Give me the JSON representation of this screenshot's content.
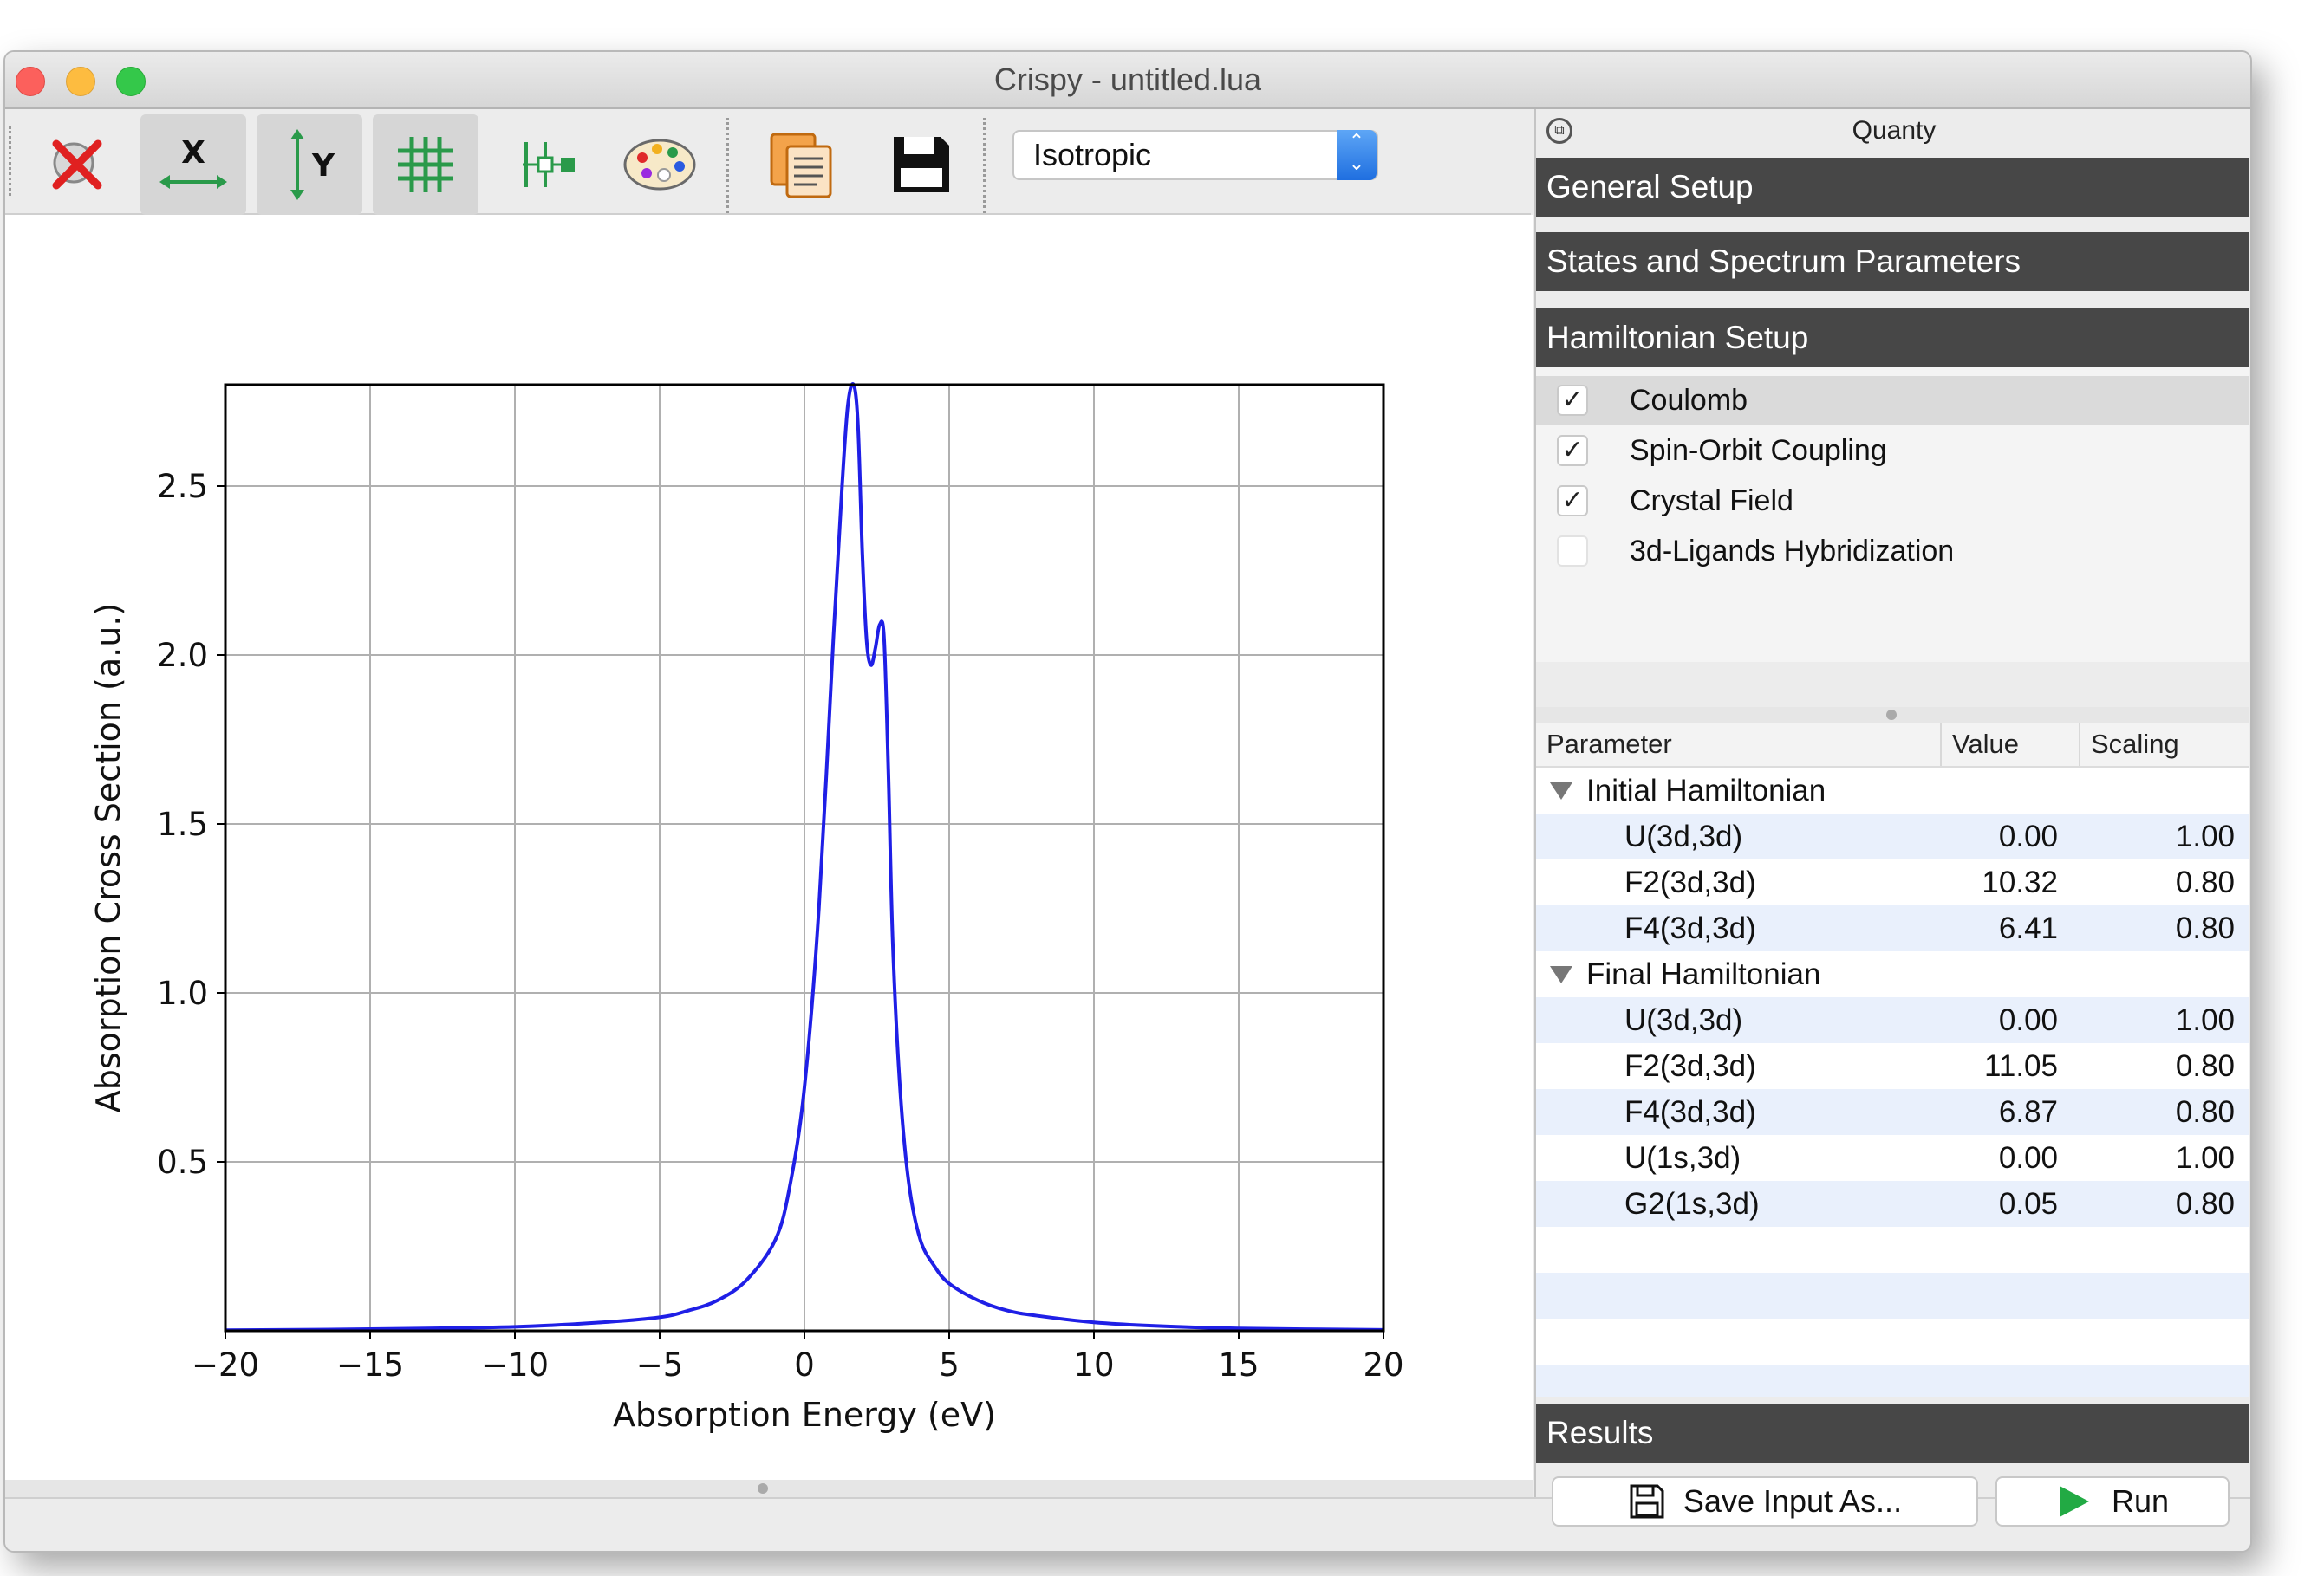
{
  "window": {
    "title": "Crispy - untitled.lua"
  },
  "toolbar": {
    "buttons": [
      {
        "name": "clear-plot",
        "icon": "clear-plot-icon"
      },
      {
        "name": "autoscale-x",
        "icon": "x-axis-scale-icon",
        "label": "X"
      },
      {
        "name": "autoscale-y",
        "icon": "y-axis-scale-icon",
        "label": "Y"
      },
      {
        "name": "grid",
        "icon": "grid-icon"
      },
      {
        "name": "curve-style",
        "icon": "curve-style-icon"
      },
      {
        "name": "colormap",
        "icon": "palette-icon"
      },
      {
        "name": "copy",
        "icon": "copy-icon"
      },
      {
        "name": "save",
        "icon": "save-icon"
      }
    ],
    "combo_value": "Isotropic"
  },
  "chart_data": {
    "type": "line",
    "title": "",
    "xlabel": "Absorption Energy (eV)",
    "ylabel": "Absorption Cross Section (a.u.)",
    "xlim": [
      -20,
      20
    ],
    "ylim": [
      0,
      2.8
    ],
    "xticks": [
      -20,
      -15,
      -10,
      -5,
      0,
      5,
      10,
      15,
      20
    ],
    "xticklabels": [
      "−20",
      "−15",
      "−10",
      "−5",
      "0",
      "5",
      "10",
      "15",
      "20"
    ],
    "yticks": [
      0.5,
      1.0,
      1.5,
      2.0,
      2.5
    ],
    "yticklabels": [
      "0.5",
      "1.0",
      "1.5",
      "2.0",
      "2.5"
    ],
    "grid": true,
    "color": "#1f1fe6",
    "series": [
      {
        "x": [
          -20,
          -15,
          -10,
          -7,
          -5,
          -4,
          -3,
          -2,
          -1,
          -0.5,
          0,
          0.5,
          1.0,
          1.3,
          1.5,
          1.7,
          1.85,
          2.0,
          2.15,
          2.3,
          2.45,
          2.6,
          2.75,
          2.9,
          3.05,
          3.3,
          3.6,
          4.0,
          4.5,
          5,
          6,
          7,
          8,
          10,
          12,
          15,
          20
        ],
        "y": [
          0.002,
          0.005,
          0.012,
          0.025,
          0.04,
          0.06,
          0.09,
          0.15,
          0.27,
          0.43,
          0.72,
          1.25,
          2.05,
          2.5,
          2.74,
          2.8,
          2.68,
          2.3,
          2.04,
          1.97,
          2.02,
          2.09,
          2.05,
          1.65,
          1.15,
          0.72,
          0.44,
          0.27,
          0.19,
          0.14,
          0.09,
          0.06,
          0.045,
          0.025,
          0.015,
          0.007,
          0.003
        ]
      }
    ]
  },
  "dock": {
    "title": "Quanty",
    "sections": {
      "general": "General Setup",
      "states": "States and Spectrum Parameters",
      "hamiltonian": "Hamiltonian Setup",
      "results": "Results"
    },
    "terms": [
      {
        "label": "Coulomb",
        "checked": "✓"
      },
      {
        "label": "Spin-Orbit Coupling",
        "checked": "✓"
      },
      {
        "label": "Crystal Field",
        "checked": "✓"
      },
      {
        "label": "3d-Ligands Hybridization",
        "checked": ""
      }
    ],
    "table": {
      "headers": [
        "Parameter",
        "Value",
        "Scaling"
      ],
      "groups": [
        {
          "name": "Initial Hamiltonian",
          "rows": [
            {
              "param": "U(3d,3d)",
              "value": "0.00",
              "scaling": "1.00"
            },
            {
              "param": "F2(3d,3d)",
              "value": "10.32",
              "scaling": "0.80"
            },
            {
              "param": "F4(3d,3d)",
              "value": "6.41",
              "scaling": "0.80"
            }
          ]
        },
        {
          "name": "Final Hamiltonian",
          "rows": [
            {
              "param": "U(3d,3d)",
              "value": "0.00",
              "scaling": "1.00"
            },
            {
              "param": "F2(3d,3d)",
              "value": "11.05",
              "scaling": "0.80"
            },
            {
              "param": "F4(3d,3d)",
              "value": "6.87",
              "scaling": "0.80"
            },
            {
              "param": "U(1s,3d)",
              "value": "0.00",
              "scaling": "1.00"
            },
            {
              "param": "G2(1s,3d)",
              "value": "0.05",
              "scaling": "0.80"
            }
          ]
        }
      ]
    },
    "buttons": {
      "save": "Save Input As...",
      "run": "Run"
    }
  }
}
